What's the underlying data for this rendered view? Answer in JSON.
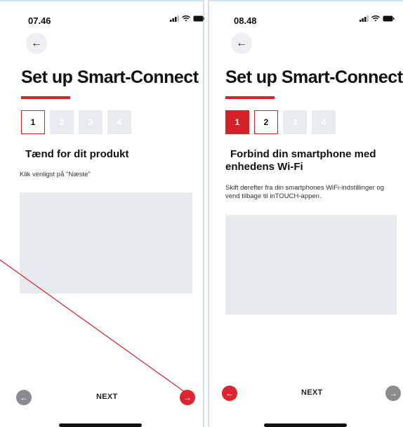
{
  "left_screen": {
    "status_time": "07.46",
    "title": "Set up Smart-Connect",
    "steps": [
      "1",
      "2",
      "3",
      "4"
    ],
    "heading": "Tænd for dit produkt",
    "description": "Klik venligst på \"Næste\"",
    "next_label": "NEXT",
    "prev_button_state": "disabled",
    "next_button_state": "enabled"
  },
  "right_screen": {
    "status_time": "08.48",
    "title": "Set up Smart-Connect",
    "steps": [
      "1",
      "2",
      "3",
      "4"
    ],
    "heading": "Forbind din smartphone med enhedens Wi-Fi",
    "description": "Skift derefter fra din smartphones WiFi-indstillinger og vend tilbage til inTOUCH-appen.",
    "next_label": "NEXT",
    "prev_button_state": "enabled",
    "next_button_state": "disabled"
  },
  "icons": {
    "back": "arrow-left-icon",
    "prev": "arrow-left-circle-icon",
    "next": "arrow-right-circle-icon",
    "signal": "signal-icon",
    "wifi": "wifi-icon",
    "battery": "battery-icon"
  },
  "colors": {
    "accent_red": "#d7202a",
    "placeholder": "#e7ebef",
    "disabled_gray": "#888b8f",
    "annotation_line": "#d7202a"
  }
}
